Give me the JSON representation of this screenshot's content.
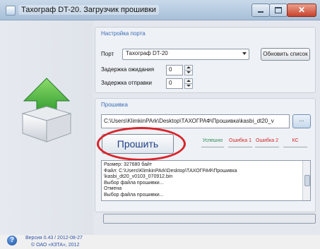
{
  "window": {
    "title": "Тахограф DT-20. Загрузчик прошивки"
  },
  "port": {
    "legend": "Настройка порта",
    "port_label": "Порт",
    "port_value": "Тахограф DT-20",
    "refresh_button": "Обновить список",
    "wait_label": "Задержка ожидания",
    "wait_value": "0",
    "send_label": "Задержка отправки",
    "send_value": "0"
  },
  "firmware": {
    "legend": "Прошивка",
    "path": "C:\\Users\\KlimkinPArk\\Desktop\\ТАХОГРАФ\\Прошивка\\kasbi_dt20_v",
    "browse_label": "...",
    "flash_button": "Прошить",
    "status": [
      {
        "label": "Успешно",
        "color": "#2e8b57"
      },
      {
        "label": "Ошибка 1",
        "color": "#d02a2a"
      },
      {
        "label": "Ошибка 2",
        "color": "#d02a2a"
      },
      {
        "label": "КС",
        "color": "#d02a2a"
      }
    ],
    "log": [
      "Размер: 327680 байт",
      "Файл: C:\\Users\\KlimkinPArk\\Desktop\\ТАХОГРАФ\\Прошивка",
      "\\kasbi_dt20_v0103_070912.bin",
      "Выбор файла прошивки...",
      "Отмена",
      "Выбор файла прошивки..."
    ]
  },
  "footer": {
    "version_line1": "Версия 0.43 / 2012-08-27",
    "version_line2": "© ОАО «КЗТА», 2012"
  }
}
